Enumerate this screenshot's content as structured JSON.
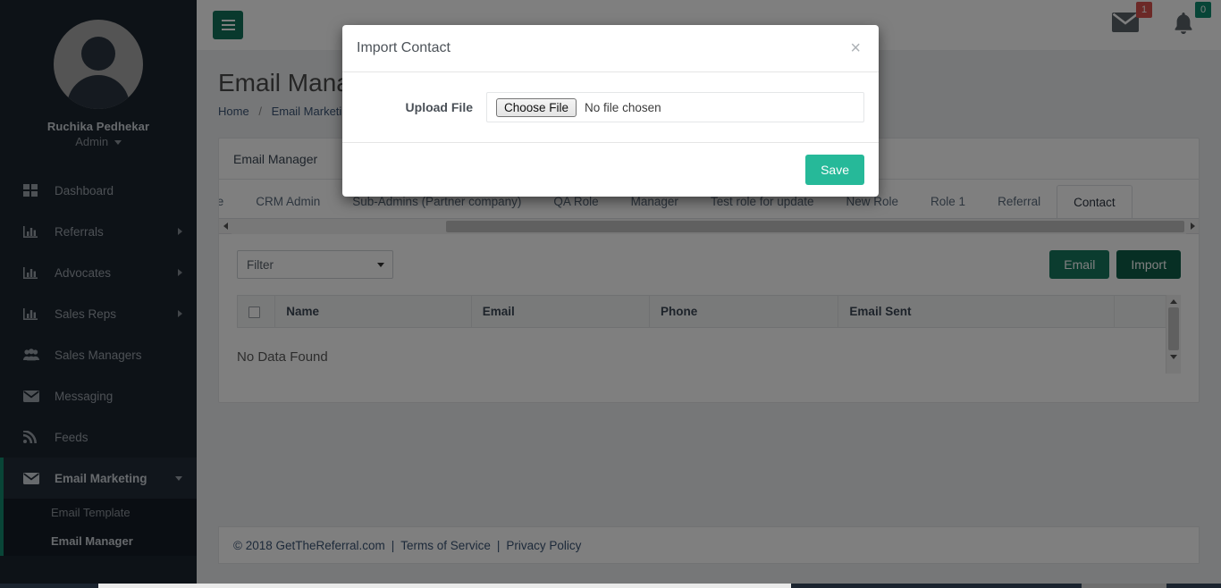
{
  "colors": {
    "sidebar_bg": "#1b242f",
    "accent_green": "#13725b",
    "save_teal": "#26b999",
    "badge_red": "#d9534f",
    "badge_green": "#0f8a6e"
  },
  "sidebar": {
    "user": {
      "name": "Ruchika Pedhekar",
      "role": "Admin"
    },
    "items": [
      {
        "label": "Dashboard",
        "icon": "grid-icon",
        "has_chevron": false
      },
      {
        "label": "Referrals",
        "icon": "bar-chart-icon",
        "has_chevron": true
      },
      {
        "label": "Advocates",
        "icon": "bar-chart-icon",
        "has_chevron": true
      },
      {
        "label": "Sales Reps",
        "icon": "bar-chart-icon",
        "has_chevron": true
      },
      {
        "label": "Sales Managers",
        "icon": "users-icon",
        "has_chevron": false
      },
      {
        "label": "Messaging",
        "icon": "envelope-icon",
        "has_chevron": false
      },
      {
        "label": "Feeds",
        "icon": "rss-icon",
        "has_chevron": false
      },
      {
        "label": "Email Marketing",
        "icon": "envelope-icon",
        "has_chevron": true,
        "expanded": true
      }
    ],
    "subitems": [
      {
        "label": "Email Template",
        "active": false
      },
      {
        "label": "Email Manager",
        "active": true
      }
    ]
  },
  "topbar": {
    "menu_toggle": "hamburger-icon",
    "messages": {
      "icon": "envelope-icon",
      "count": "1"
    },
    "notifications": {
      "icon": "bell-icon",
      "count": "0"
    }
  },
  "page": {
    "title": "Email Manager",
    "breadcrumb": {
      "home": "Home",
      "separator": "/",
      "current": "Email Marketing"
    }
  },
  "panel": {
    "heading": "Email Manager"
  },
  "tabs": [
    {
      "label": "ive",
      "active": false,
      "clipped": true
    },
    {
      "label": "CRM Admin",
      "active": false
    },
    {
      "label": "Sub-Admins (Partner company)",
      "active": false
    },
    {
      "label": "QA Role",
      "active": false
    },
    {
      "label": "Manager",
      "active": false
    },
    {
      "label": "Test role for update",
      "active": false
    },
    {
      "label": "New Role",
      "active": false
    },
    {
      "label": "Role 1",
      "active": false
    },
    {
      "label": "Referral",
      "active": false
    },
    {
      "label": "Contact",
      "active": true
    }
  ],
  "toolbar": {
    "filter_label": "Filter",
    "email_button": "Email",
    "import_button": "Import"
  },
  "table": {
    "columns": [
      "",
      "Name",
      "Email",
      "Phone",
      "Email Sent",
      ""
    ],
    "rows": [],
    "empty_message": "No Data Found"
  },
  "footer": {
    "copyright": "© 2018 GetTheReferral.com",
    "pipe1": "|",
    "terms": "Terms of Service",
    "pipe2": "|",
    "privacy": "Privacy Policy"
  },
  "modal": {
    "title": "Import Contact",
    "close": "×",
    "upload_label": "Upload File",
    "choose_file_button": "Choose File",
    "file_status": "No file chosen",
    "save_button": "Save"
  }
}
